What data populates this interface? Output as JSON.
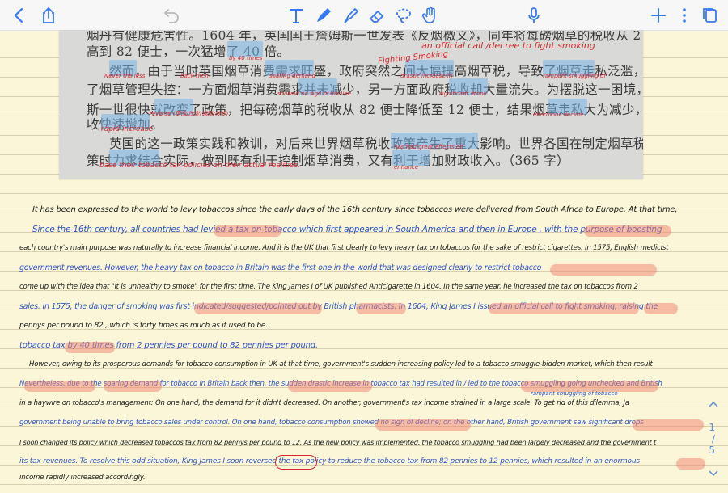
{
  "toolbar": {
    "icons": [
      "chevron-left-icon",
      "share-icon",
      "undo-icon",
      "text-tool-icon",
      "pen-icon",
      "highlighter-icon",
      "eraser-icon",
      "lasso-icon",
      "hand-icon",
      "microphone-icon",
      "plus-icon",
      "more-icon",
      "pages-icon"
    ],
    "accent": "#3478f6"
  },
  "photo": {
    "lines": [
      {
        "text": "烟丹有健康危害性。1604 年，英国国王詹姆斯一世发表《反烟檄文》，同年将每磅烟草的税收从 2 便士提"
      },
      {
        "text": "高到 82 便士，一次猛增了 40 倍。"
      },
      {
        "text": "然而，由于当时英国烟草消费需求旺盛，政府突然之间大幅提高烟草税，导致了烟草走私泛滥，造成"
      },
      {
        "text": "了烟草管理失控：一方面烟草消费需求并未减少，另一方面政府税收却大量流失。为摆脱这一困境，詹姆"
      },
      {
        "text": "斯一世很快就改变了政策，把每磅烟草的税收从 82 便士降低至 12 便士，结果烟草走私大为减少，政府税"
      },
      {
        "text": "收快速增加。"
      },
      {
        "text": "英国的这一政策实践和教训，对后来世界烟草税收政策产生了重大影响。世界各国在制定烟草税收政"
      },
      {
        "text": "策时力求结合实际，做到既有利于控制烟草消费，又有利于增加财政收入。（365 字）"
      }
    ],
    "annotations": [
      "an official call /decree to fight smoking",
      "by 40 times",
      "Never the less",
      "back then",
      "soaring demand",
      "Fighting Smoking",
      "drastic increase in",
      "rampant smuggling of",
      "showed no sign of decline",
      "significant drops",
      "reverse (更改/改变/调整/转变)",
      "rapid increase",
      "enormous decline",
      "has had great effects on",
      "base their tobacco tax policies on their actual realities.",
      "enhance"
    ]
  },
  "notes": {
    "lines": [
      {
        "text": "It has been expressed to the world to  levy  tobaccos since the early days of the 16th century since tobaccos were delivered from South Africa to Europe. At that time,"
      },
      {
        "text": "Since the 16th century, all countries had levied a tax on tobacco which first appeared in South America and then in Europe , with the purpose of boosting"
      },
      {
        "text": "each country's main purpose was naturally to increase financial income. And it is the UK that first clearly to levy heavy tax on tobaccos for the sake of restrict cigarettes. In 1575, English medicist"
      },
      {
        "text": "government revenues.                          However, the heavy tax on tobacco in Britain was the first one in the world that was designed clearly to restrict tobacco"
      },
      {
        "text": "come up with the idea that \"it is unhealthy to smoke\" for the first time. The King James I of UK published Anticigarette in 1604. In the same year, he increased the tax on tobaccos from 2"
      },
      {
        "text": "sales. In 1575, the danger of smoking was first indicated/suggested/pointed out by British pharmacists. In 1604, King James I issued an official call to fight smoking, raising the"
      },
      {
        "text": "pennys per pound to 82 , which is forty times as much as it used to be."
      },
      {
        "text": "tobacco tax by 40 times from 2 pennies per pound to 82 pennies per pound."
      },
      {
        "text": "However, owing to its prosperous demands for tobacco consumption in UK at that time, government's sudden increasing policy led to a tobacco smuggle-bidden market, which then result"
      },
      {
        "text": "Nevertheless, due to the soaring demand for tobacco in Britain back then, the sudden drastic increase in tobacco tax had resulted in / led to the tobacco smuggling going unchecked and British"
      },
      {
        "text": "in a haywire on tobacco's management: On one hand, the demand for it didn't decreased. On another, government's tax income strained in a large scale.  To get rid of this dilemma, Ja"
      },
      {
        "text": "government being unable to bring tobacco sales under control. On one hand, tobacco consumption showed no sign of decline; on the other hand, British government saw significant drops"
      },
      {
        "text": "I soon changed its policy which decreased tobaccos tax from 82 pennys per pound to 12. As the new policy was implemented, the tobacco smuggling had been largely decreased and the government t"
      },
      {
        "text": "its tax revenues. To resolve this odd situation, King James I soon reversed the tax policy to reduce the tobacco tax from 82 pennies to 12 pennies, which resulted in an enormous"
      },
      {
        "text": "income rapidly increased accordingly."
      }
    ],
    "small_annotation": "rampant smuggling of tobacco"
  },
  "pager": {
    "current": "1",
    "divider": "/",
    "total": "5"
  }
}
